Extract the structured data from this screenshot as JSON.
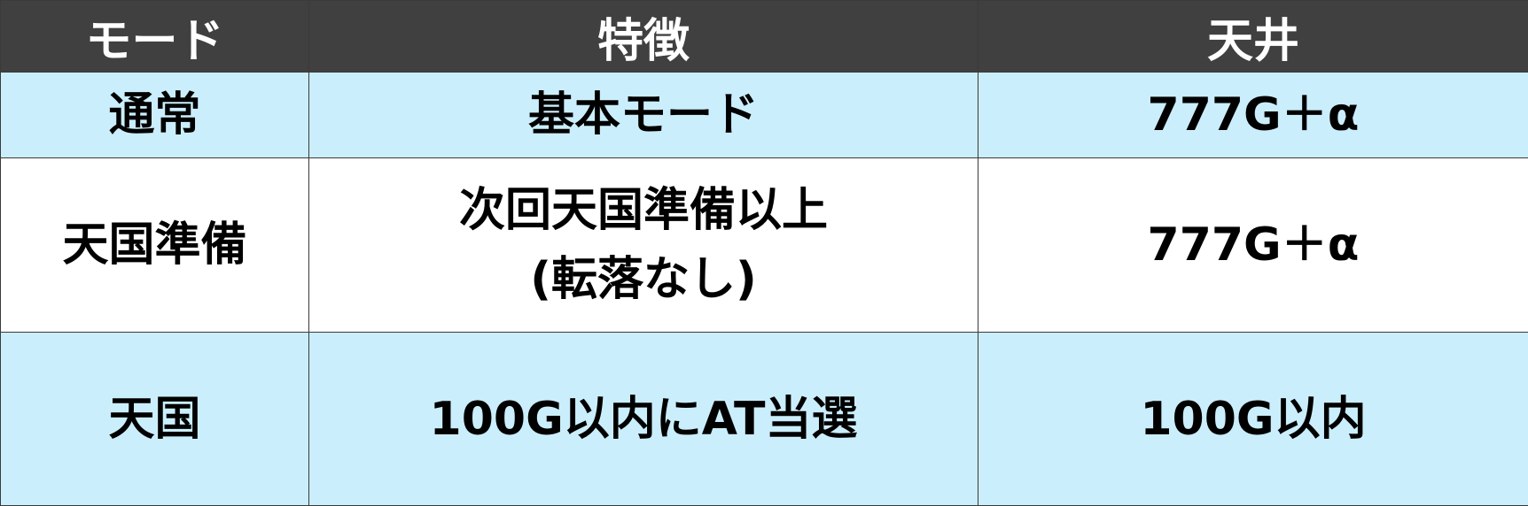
{
  "colors": {
    "header_bg": "#404040",
    "header_text": "#ffffff",
    "row_blue": "#cbeefc",
    "row_white": "#ffffff",
    "border": "#3a3a3a"
  },
  "headers": {
    "mode": "モード",
    "feature": "特徴",
    "ceiling": "天井"
  },
  "rows": [
    {
      "mode": "通常",
      "feature_lines": [
        "基本モード"
      ],
      "ceiling": "777G＋α"
    },
    {
      "mode": "天国準備",
      "feature_lines": [
        "次回天国準備以上",
        "(転落なし)"
      ],
      "ceiling": "777G＋α"
    },
    {
      "mode": "天国",
      "feature_lines": [
        "100G以内にAT当選"
      ],
      "ceiling": "100G以内"
    }
  ]
}
